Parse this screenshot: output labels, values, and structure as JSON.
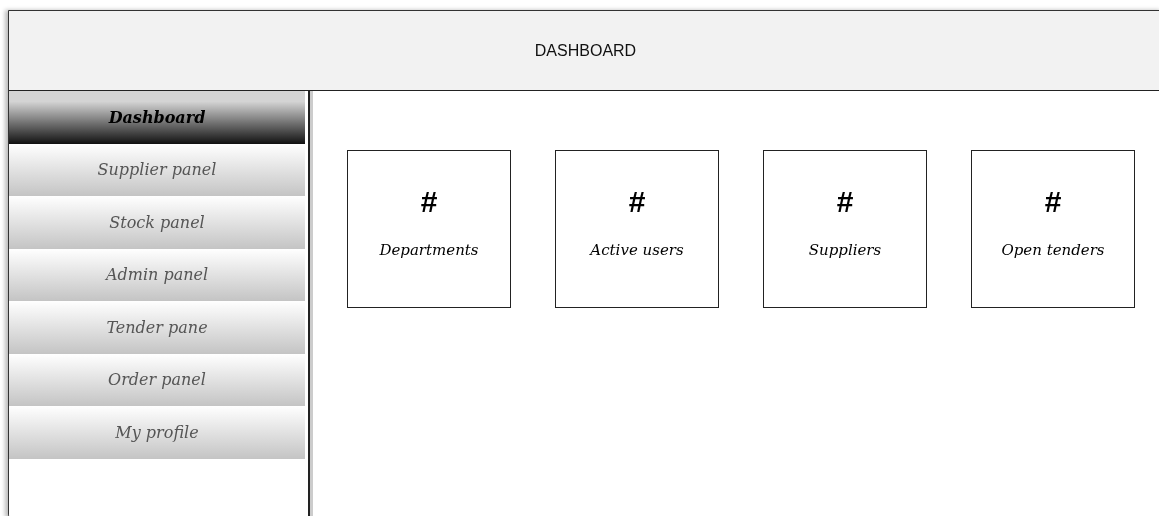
{
  "header": {
    "title": "DASHBOARD"
  },
  "sidebar": {
    "items": [
      {
        "label": "Dashboard",
        "selected": true
      },
      {
        "label": "Supplier panel",
        "selected": false
      },
      {
        "label": "Stock panel",
        "selected": false
      },
      {
        "label": "Admin panel",
        "selected": false
      },
      {
        "label": "Tender pane",
        "selected": false
      },
      {
        "label": "Order panel",
        "selected": false
      },
      {
        "label": "My profile",
        "selected": false
      }
    ]
  },
  "cards": [
    {
      "value": "#",
      "label": "Departments"
    },
    {
      "value": "#",
      "label": "Active users"
    },
    {
      "value": "#",
      "label": "Suppliers"
    },
    {
      "value": "#",
      "label": "Open tenders"
    }
  ]
}
